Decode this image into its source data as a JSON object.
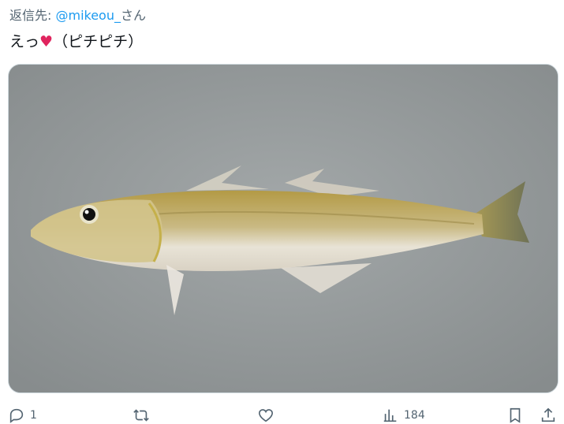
{
  "reply": {
    "prefix": "返信先: ",
    "handle": "@mikeou_",
    "suffix": "さん"
  },
  "tweet": {
    "text_before": "えっ",
    "heart": "♥",
    "text_after": "（ピチピチ）"
  },
  "media": {
    "alt": "fish-photo"
  },
  "actions": {
    "reply_count": "1",
    "retweet_count": "",
    "like_count": "",
    "views_count": "184"
  },
  "colors": {
    "link": "#1d9bf0",
    "heart": "#e0245e",
    "muted": "#536471"
  }
}
